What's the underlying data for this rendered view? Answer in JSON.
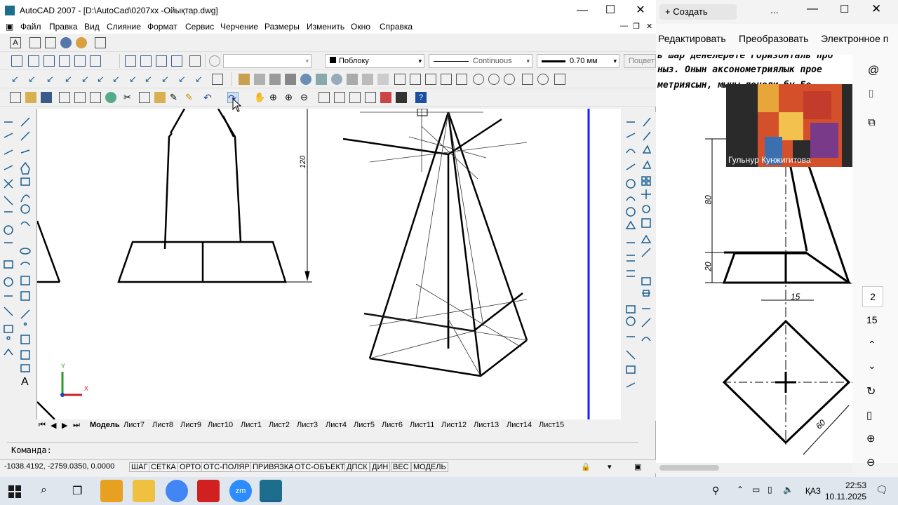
{
  "cad": {
    "title": "AutoCAD 2007 - [D:\\AutoCad\\0207xx -Ойықтар.dwg]",
    "menu": [
      "Файл",
      "Правка",
      "Вид",
      "Слияние",
      "Формат",
      "Сервис",
      "Черчение",
      "Размеры",
      "Изменить",
      "Окно",
      "Справка"
    ],
    "layer_color": "Поблоку",
    "linetype": "Continuous",
    "lineweight": "0.70 мм",
    "plot_style": "Поцвету",
    "dimension_label": "120",
    "tabs": [
      "Модель",
      "Лист7",
      "Лист8",
      "Лист9",
      "Лист10",
      "Лист1",
      "Лист2",
      "Лист3",
      "Лист4",
      "Лист5",
      "Лист6",
      "Лист11",
      "Лист12",
      "Лист13",
      "Лист14",
      "Лист15"
    ],
    "command_prompt": "Команда:",
    "coordinates": "-1038.4192, -2759.0350, 0.0000",
    "status_buttons": [
      "ШАГ",
      "СЕТКА",
      "ОРТО",
      "ОТС-ПОЛЯР",
      "ПРИВЯЗКА",
      "ОТС-ОБЪЕКТ",
      "ДПСК",
      "ДИН",
      "ВЕС",
      "МОДЕЛЬ"
    ],
    "ucs_x": "X",
    "ucs_y": "Y",
    "colors": {
      "accent_blue": "#1a1aff",
      "title_bg": "#ffffff"
    }
  },
  "pdf": {
    "create_label": "Создать",
    "more_label": "...",
    "toolbar": [
      "Редактировать",
      "Преобразовать",
      "Электронное п"
    ],
    "handwritten": [
      "ь шар денелерөте горизонталь про",
      "ныз. Онын аксонометриялык  прое",
      "метриясын, мыны денели бу Бо"
    ],
    "video_name": "Гульнур Кунжигитова",
    "page_current": "2",
    "page_total": "15",
    "dims": {
      "d80": "80",
      "d20": "20",
      "d15": "15",
      "d60": "60"
    }
  },
  "taskbar": {
    "lang": "ҚАЗ",
    "time": "22:53",
    "date": "10.11.2025"
  }
}
